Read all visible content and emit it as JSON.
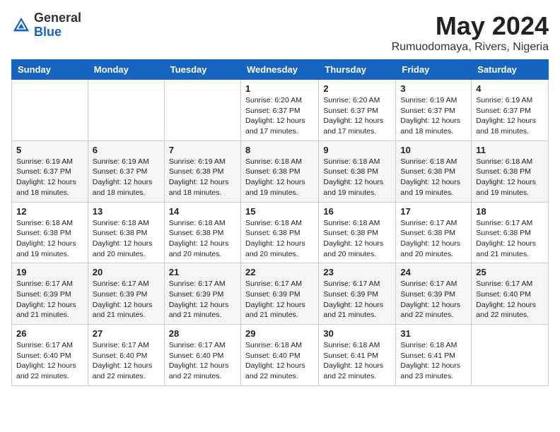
{
  "header": {
    "logo_general": "General",
    "logo_blue": "Blue",
    "month": "May 2024",
    "location": "Rumuodomaya, Rivers, Nigeria"
  },
  "weekdays": [
    "Sunday",
    "Monday",
    "Tuesday",
    "Wednesday",
    "Thursday",
    "Friday",
    "Saturday"
  ],
  "weeks": [
    [
      {
        "day": "",
        "content": ""
      },
      {
        "day": "",
        "content": ""
      },
      {
        "day": "",
        "content": ""
      },
      {
        "day": "1",
        "content": "Sunrise: 6:20 AM\nSunset: 6:37 PM\nDaylight: 12 hours\nand 17 minutes."
      },
      {
        "day": "2",
        "content": "Sunrise: 6:20 AM\nSunset: 6:37 PM\nDaylight: 12 hours\nand 17 minutes."
      },
      {
        "day": "3",
        "content": "Sunrise: 6:19 AM\nSunset: 6:37 PM\nDaylight: 12 hours\nand 18 minutes."
      },
      {
        "day": "4",
        "content": "Sunrise: 6:19 AM\nSunset: 6:37 PM\nDaylight: 12 hours\nand 18 minutes."
      }
    ],
    [
      {
        "day": "5",
        "content": "Sunrise: 6:19 AM\nSunset: 6:37 PM\nDaylight: 12 hours\nand 18 minutes."
      },
      {
        "day": "6",
        "content": "Sunrise: 6:19 AM\nSunset: 6:37 PM\nDaylight: 12 hours\nand 18 minutes."
      },
      {
        "day": "7",
        "content": "Sunrise: 6:19 AM\nSunset: 6:38 PM\nDaylight: 12 hours\nand 18 minutes."
      },
      {
        "day": "8",
        "content": "Sunrise: 6:18 AM\nSunset: 6:38 PM\nDaylight: 12 hours\nand 19 minutes."
      },
      {
        "day": "9",
        "content": "Sunrise: 6:18 AM\nSunset: 6:38 PM\nDaylight: 12 hours\nand 19 minutes."
      },
      {
        "day": "10",
        "content": "Sunrise: 6:18 AM\nSunset: 6:38 PM\nDaylight: 12 hours\nand 19 minutes."
      },
      {
        "day": "11",
        "content": "Sunrise: 6:18 AM\nSunset: 6:38 PM\nDaylight: 12 hours\nand 19 minutes."
      }
    ],
    [
      {
        "day": "12",
        "content": "Sunrise: 6:18 AM\nSunset: 6:38 PM\nDaylight: 12 hours\nand 19 minutes."
      },
      {
        "day": "13",
        "content": "Sunrise: 6:18 AM\nSunset: 6:38 PM\nDaylight: 12 hours\nand 20 minutes."
      },
      {
        "day": "14",
        "content": "Sunrise: 6:18 AM\nSunset: 6:38 PM\nDaylight: 12 hours\nand 20 minutes."
      },
      {
        "day": "15",
        "content": "Sunrise: 6:18 AM\nSunset: 6:38 PM\nDaylight: 12 hours\nand 20 minutes."
      },
      {
        "day": "16",
        "content": "Sunrise: 6:18 AM\nSunset: 6:38 PM\nDaylight: 12 hours\nand 20 minutes."
      },
      {
        "day": "17",
        "content": "Sunrise: 6:17 AM\nSunset: 6:38 PM\nDaylight: 12 hours\nand 20 minutes."
      },
      {
        "day": "18",
        "content": "Sunrise: 6:17 AM\nSunset: 6:38 PM\nDaylight: 12 hours\nand 21 minutes."
      }
    ],
    [
      {
        "day": "19",
        "content": "Sunrise: 6:17 AM\nSunset: 6:39 PM\nDaylight: 12 hours\nand 21 minutes."
      },
      {
        "day": "20",
        "content": "Sunrise: 6:17 AM\nSunset: 6:39 PM\nDaylight: 12 hours\nand 21 minutes."
      },
      {
        "day": "21",
        "content": "Sunrise: 6:17 AM\nSunset: 6:39 PM\nDaylight: 12 hours\nand 21 minutes."
      },
      {
        "day": "22",
        "content": "Sunrise: 6:17 AM\nSunset: 6:39 PM\nDaylight: 12 hours\nand 21 minutes."
      },
      {
        "day": "23",
        "content": "Sunrise: 6:17 AM\nSunset: 6:39 PM\nDaylight: 12 hours\nand 21 minutes."
      },
      {
        "day": "24",
        "content": "Sunrise: 6:17 AM\nSunset: 6:39 PM\nDaylight: 12 hours\nand 22 minutes."
      },
      {
        "day": "25",
        "content": "Sunrise: 6:17 AM\nSunset: 6:40 PM\nDaylight: 12 hours\nand 22 minutes."
      }
    ],
    [
      {
        "day": "26",
        "content": "Sunrise: 6:17 AM\nSunset: 6:40 PM\nDaylight: 12 hours\nand 22 minutes."
      },
      {
        "day": "27",
        "content": "Sunrise: 6:17 AM\nSunset: 6:40 PM\nDaylight: 12 hours\nand 22 minutes."
      },
      {
        "day": "28",
        "content": "Sunrise: 6:17 AM\nSunset: 6:40 PM\nDaylight: 12 hours\nand 22 minutes."
      },
      {
        "day": "29",
        "content": "Sunrise: 6:18 AM\nSunset: 6:40 PM\nDaylight: 12 hours\nand 22 minutes."
      },
      {
        "day": "30",
        "content": "Sunrise: 6:18 AM\nSunset: 6:41 PM\nDaylight: 12 hours\nand 22 minutes."
      },
      {
        "day": "31",
        "content": "Sunrise: 6:18 AM\nSunset: 6:41 PM\nDaylight: 12 hours\nand 23 minutes."
      },
      {
        "day": "",
        "content": ""
      }
    ]
  ]
}
